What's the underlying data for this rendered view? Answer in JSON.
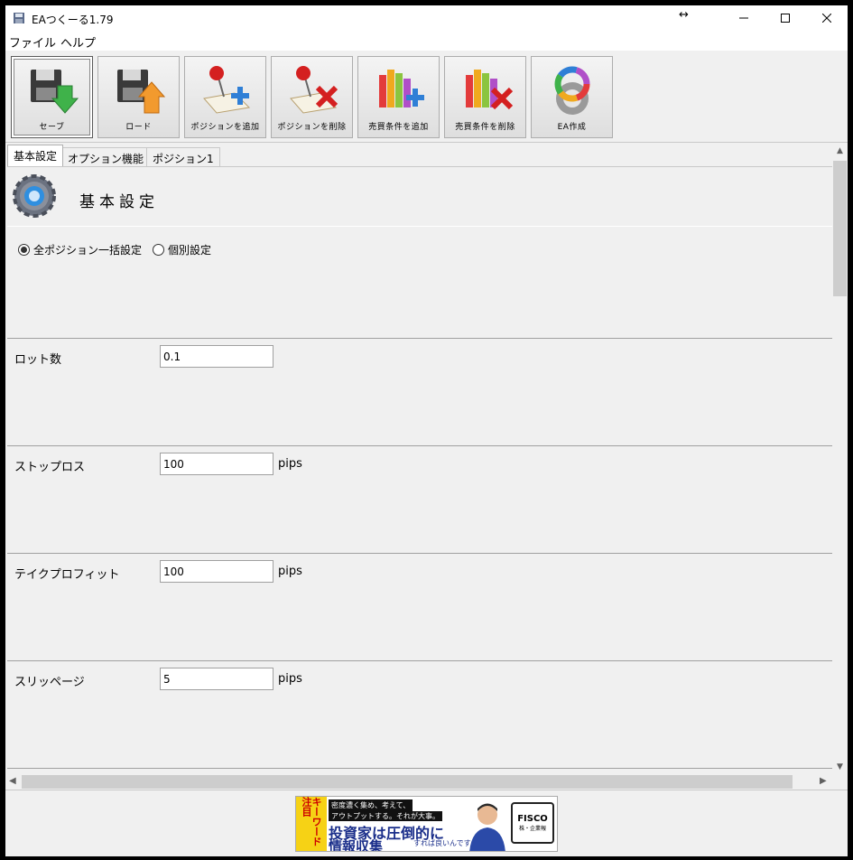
{
  "window": {
    "title": "EAつくーる1.79",
    "resize_indicator": "↔",
    "controls": {
      "minimize": "—",
      "maximize": "☐",
      "close": "✕"
    }
  },
  "menu": [
    "ファイル",
    "ヘルプ"
  ],
  "toolbar": [
    {
      "label": "セーブ",
      "icon": "save-icon"
    },
    {
      "label": "ロード",
      "icon": "load-icon"
    },
    {
      "label": "ポジションを追加",
      "icon": "add-position-icon"
    },
    {
      "label": "ポジションを削除",
      "icon": "delete-position-icon"
    },
    {
      "label": "売買条件を追加",
      "icon": "add-condition-icon"
    },
    {
      "label": "売買条件を削除",
      "icon": "delete-condition-icon"
    },
    {
      "label": "EA作成",
      "icon": "create-ea-icon"
    }
  ],
  "tabs": [
    "基本設定",
    "オプション機能",
    "ポジション1"
  ],
  "section": {
    "title": "基本設定",
    "mode_options": [
      {
        "label": "全ポジション一括設定",
        "selected": true
      },
      {
        "label": "個別設定",
        "selected": false
      }
    ]
  },
  "fields": [
    {
      "label": "ロット数",
      "value": "0.1",
      "unit": ""
    },
    {
      "label": "ストップロス",
      "value": "100",
      "unit": "pips"
    },
    {
      "label": "テイクプロフィット",
      "value": "100",
      "unit": "pips"
    },
    {
      "label": "スリッページ",
      "value": "5",
      "unit": "pips"
    }
  ],
  "ad": {
    "tag": "キーワード注目",
    "banner_line1": "密度濃く集め、考えて、",
    "banner_line2": "アウトプットする。それが大事。",
    "headline1": "投資家は圧倒的に",
    "headline2": "情報収集",
    "sub": "すれば良いんですよ!",
    "logo": "FISCO",
    "logo_sub": "株・企業報"
  },
  "colors": {
    "accent_blue": "#1a2e8a",
    "ad_yellow": "#f6d215"
  }
}
